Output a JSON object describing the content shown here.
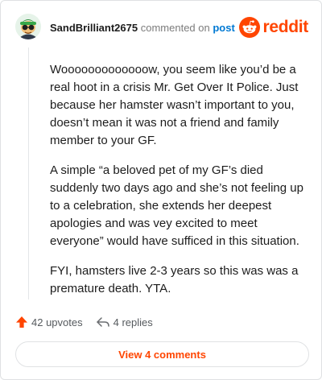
{
  "header": {
    "username": "SandBrilliant2675",
    "action_text": "commented on",
    "post_link": "post",
    "logo_text": "reddit"
  },
  "comment": {
    "paragraphs": [
      "Wooooooooooooow, you seem like you’d be a real hoot in a crisis Mr. Get Over It Police. Just because her hamster wasn’t important to you, doesn’t mean it was not a friend and family member to your GF.",
      "A simple “a beloved pet of my GF’s died suddenly two days ago and she’s not feeling up to a celebration, she extends her deepest apologies and was vey excited to meet everyone” would have sufficed in this situation.",
      "FYI, hamsters live 2-3 years so this was was a premature death. YTA."
    ]
  },
  "actions": {
    "upvotes": "42 upvotes",
    "replies": "4 replies"
  },
  "footer": {
    "view_label": "View 4 comments"
  },
  "icons": {
    "upvote": "upvote-arrow-icon",
    "reply": "reply-arrow-icon",
    "logo": "reddit-snoo-icon",
    "avatar": "user-avatar"
  },
  "colors": {
    "accent": "#ff4500",
    "link": "#0079d3",
    "muted": "#7c7c7c"
  }
}
